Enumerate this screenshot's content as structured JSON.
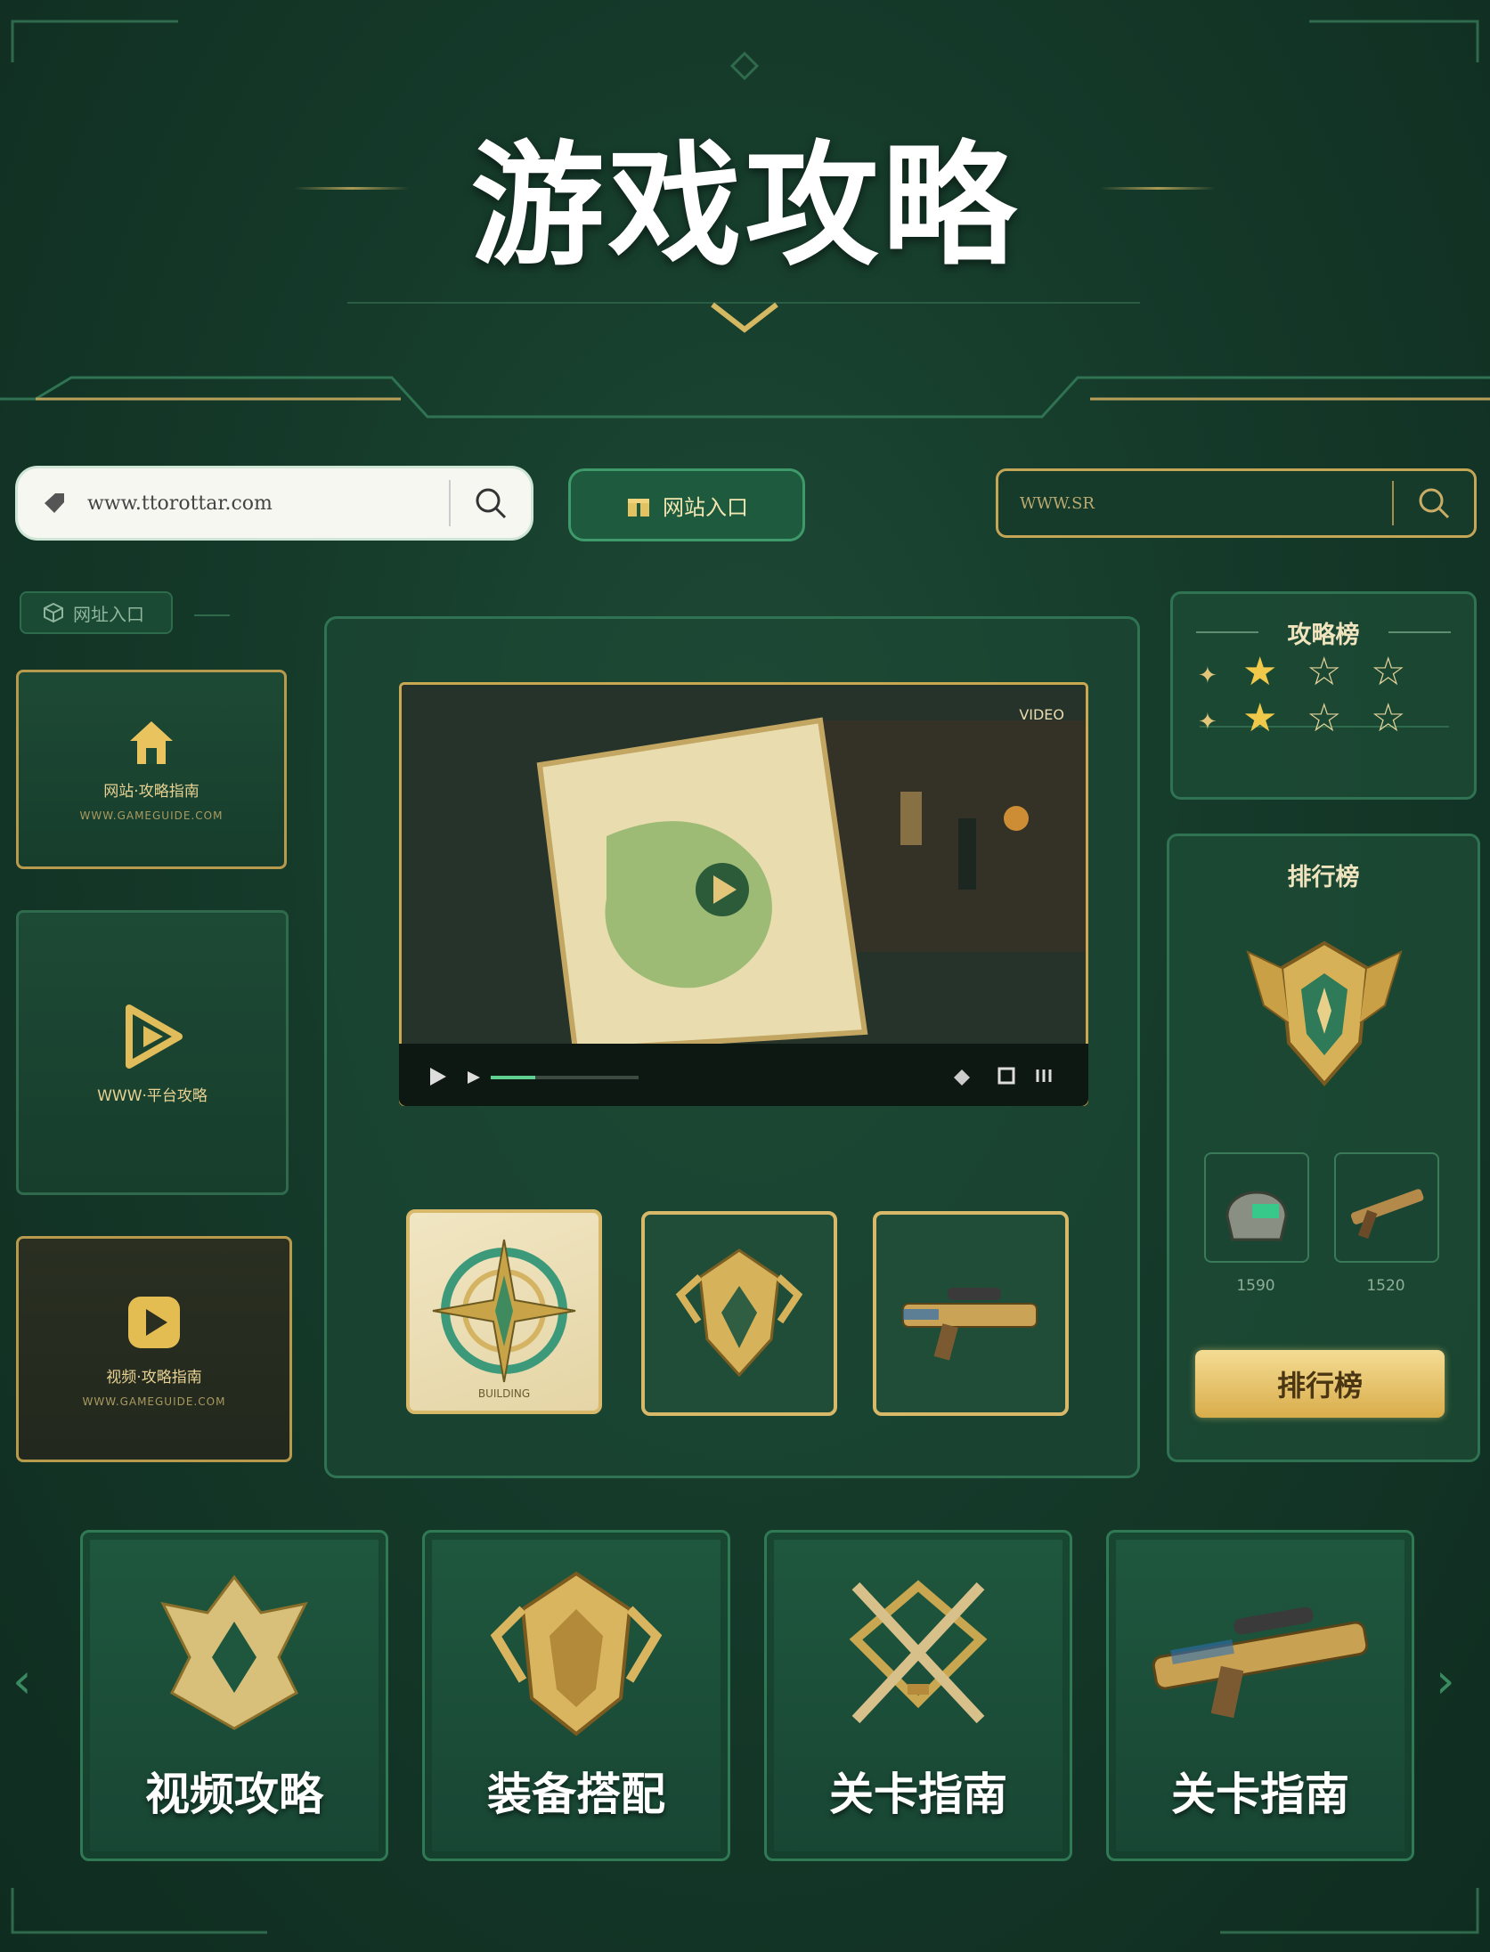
{
  "header": {
    "title": "游戏攻略"
  },
  "search_left": {
    "value": "www.ttorottar.com",
    "icon": "search-icon"
  },
  "portal_button": {
    "label": "网站入口",
    "icon": "gift-icon"
  },
  "search_right": {
    "value": "WWW.SR",
    "icon": "search-icon"
  },
  "small_portal": {
    "label": "网址入口",
    "icon": "cube-icon"
  },
  "left_cards": [
    {
      "icon": "home-icon",
      "line1": "网站·攻略指南",
      "line2": "WWW.GAMEGUIDE.COM"
    },
    {
      "icon": "play-icon",
      "line1": "WWW·平台攻略",
      "line2": ""
    },
    {
      "icon": "play-icon",
      "line1": "视频·攻略指南",
      "line2": "WWW.GAMEGUIDE.COM"
    }
  ],
  "video": {
    "corner_text": "VIDEO",
    "progress": 0.3
  },
  "thumbs": [
    {
      "icon": "compass-icon",
      "caption": "BUILDING"
    },
    {
      "icon": "crest-icon",
      "caption": ""
    },
    {
      "icon": "rifle-icon",
      "caption": ""
    }
  ],
  "strategy_board": {
    "title": "攻略榜",
    "rows": [
      {
        "filled": 1,
        "total": 3
      },
      {
        "filled": 1,
        "total": 3
      }
    ]
  },
  "ranking_board": {
    "title": "排行榜",
    "items": [
      {
        "icon": "helmet-icon",
        "price": "1590"
      },
      {
        "icon": "rifle-icon",
        "price": "1520"
      }
    ],
    "button_label": "排行榜"
  },
  "bottom_tiles": [
    {
      "icon": "crest-icon",
      "label": "视频攻略"
    },
    {
      "icon": "shield-icon",
      "label": "装备搭配"
    },
    {
      "icon": "swords-icon",
      "label": "关卡指南"
    },
    {
      "icon": "rifle-icon",
      "label": "关卡指南"
    }
  ],
  "colors": {
    "accent_gold": "#d8b96a",
    "bg_green": "#153a2a",
    "frame_green": "#2f7352"
  }
}
